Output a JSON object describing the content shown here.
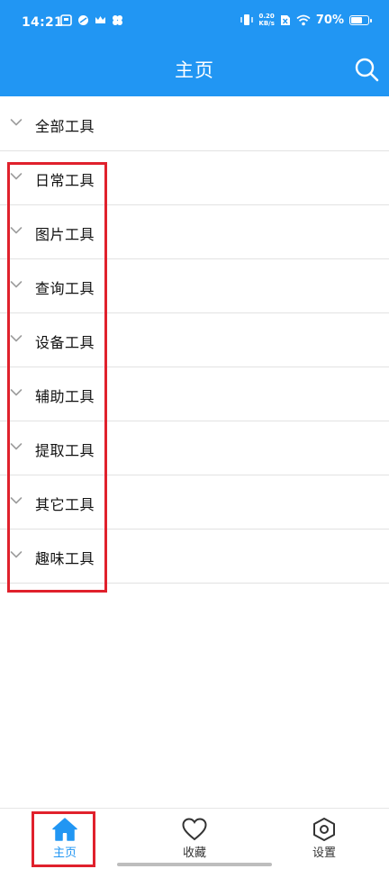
{
  "status_bar": {
    "time": "14:21",
    "net_speed_value": "0.20",
    "net_speed_unit": "KB/s",
    "battery_percent": "70%",
    "battery_level": 0.7
  },
  "header": {
    "title": "主页",
    "search_icon": "search-icon"
  },
  "categories": [
    "全部工具",
    "日常工具",
    "图片工具",
    "查询工具",
    "设备工具",
    "辅助工具",
    "提取工具",
    "其它工具",
    "趣味工具"
  ],
  "bottom_nav": {
    "home": "主页",
    "favorites": "收藏",
    "settings": "设置"
  },
  "colors": {
    "accent": "#2196F3",
    "annotation_red": "#e0212c"
  }
}
